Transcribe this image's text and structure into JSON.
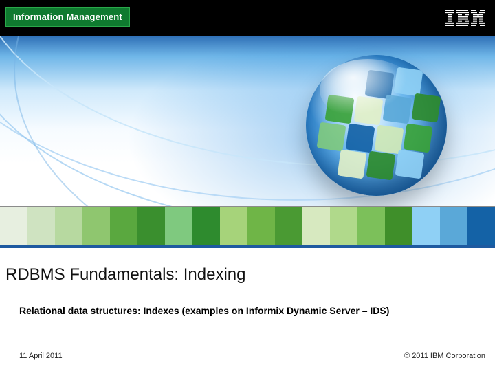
{
  "brand": {
    "badge_text": "Information Management",
    "logo_alt": "IBM"
  },
  "slide": {
    "title": "RDBMS Fundamentals: Indexing",
    "subtitle": "Relational data structures: Indexes (examples on Informix Dynamic Server –  IDS)",
    "date": "11 April 2011",
    "copyright": "© 2011 IBM Corporation"
  },
  "palette": {
    "band": [
      "#e7efe0",
      "#cfe3c1",
      "#b7d9a0",
      "#8fc66f",
      "#5aa83f",
      "#3a8f2e",
      "#7fc97f",
      "#2e8b2e",
      "#a6d37a",
      "#6fb547",
      "#4a9a33",
      "#d7e9c0",
      "#b0d98b",
      "#7cc05a",
      "#3f8f2a",
      "#8fd0f5",
      "#5aa8d8",
      "#1462a6"
    ]
  }
}
